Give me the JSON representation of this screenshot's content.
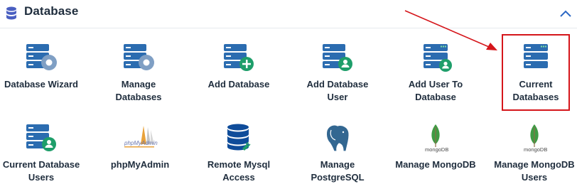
{
  "header": {
    "title": "Database",
    "icon": "database-icon",
    "collapse_icon": "chevron-up-icon"
  },
  "tiles": [
    {
      "label": "Database Wizard",
      "icon": "database-gear-icon"
    },
    {
      "label": "Manage\nDatabases",
      "icon": "database-gear-icon"
    },
    {
      "label": "Add Database",
      "icon": "database-add-icon"
    },
    {
      "label": "Add Database\nUser",
      "icon": "database-user-icon"
    },
    {
      "label": "Add User To\nDatabase",
      "icon": "database-server-icon"
    },
    {
      "label": "Current\nDatabases",
      "icon": "database-server-icon"
    },
    {
      "label": "Current Database\nUsers",
      "icon": "database-user-icon"
    },
    {
      "label": "phpMyAdmin",
      "icon": "phpmyadmin-logo"
    },
    {
      "label": "Remote Mysql\nAccess",
      "icon": "database-plug-icon"
    },
    {
      "label": "Manage\nPostgreSQL",
      "icon": "postgresql-elephant-icon"
    },
    {
      "label": "Manage MongoDB",
      "icon": "mongodb-leaf-icon"
    },
    {
      "label": "Manage MongoDB\nUsers",
      "icon": "mongodb-leaf-icon"
    }
  ],
  "logo_text": {
    "phpmyadmin": "phpMyAdmin",
    "mongodb": "mongoDB"
  },
  "colors": {
    "icon_blue": "#2b6cb0",
    "icon_gear": "#7f9fc4",
    "icon_green": "#1e9e6a",
    "highlight": "#d5161b",
    "text": "#1f2d3d"
  }
}
